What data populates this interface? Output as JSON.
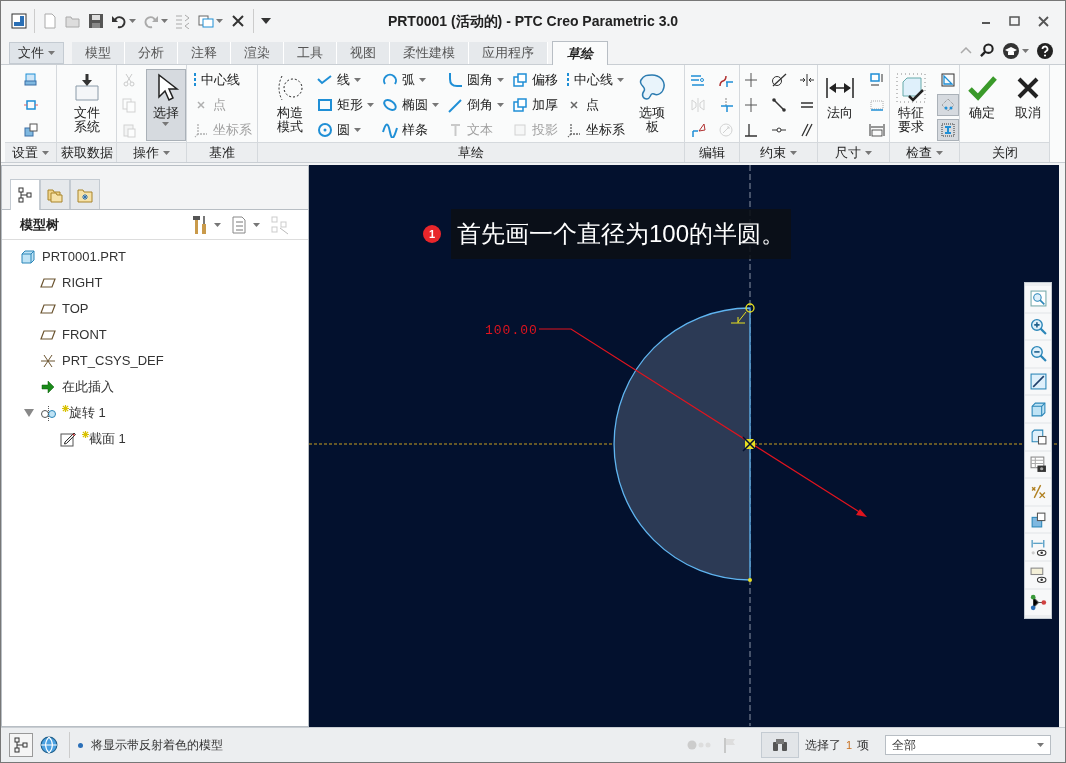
{
  "window": {
    "title": "PRT0001 (活动的) - PTC Creo Parametric 3.0"
  },
  "ribbon_tabs": [
    {
      "label": "文件",
      "kind": "menu",
      "selected": false
    },
    {
      "label": "模型",
      "kind": "tab",
      "selected": false
    },
    {
      "label": "分析",
      "kind": "tab",
      "selected": false
    },
    {
      "label": "注释",
      "kind": "tab",
      "selected": false
    },
    {
      "label": "渲染",
      "kind": "tab",
      "selected": false
    },
    {
      "label": "工具",
      "kind": "tab",
      "selected": false
    },
    {
      "label": "视图",
      "kind": "tab",
      "selected": false
    },
    {
      "label": "柔性建模",
      "kind": "tab",
      "selected": false
    },
    {
      "label": "应用程序",
      "kind": "tab",
      "selected": false
    },
    {
      "label": "草绘",
      "kind": "tab",
      "selected": true
    }
  ],
  "ribbon_groups": [
    {
      "label": "设置",
      "dropdown": true,
      "columns": [
        [
          {
            "kind": "icon",
            "dropdown": false,
            "disabled": false,
            "pressed": false
          },
          {
            "kind": "icon",
            "dropdown": false,
            "disabled": false,
            "pressed": false
          },
          {
            "kind": "icon",
            "dropdown": false,
            "disabled": false,
            "pressed": false
          }
        ]
      ]
    },
    {
      "label": "获取数据",
      "dropdown": false,
      "columns": [
        [
          {
            "kind": "large",
            "label": "文件系统",
            "dropdown": false,
            "disabled": false,
            "pressed": false
          }
        ]
      ]
    },
    {
      "label": "操作",
      "dropdown": true,
      "columns": [
        [
          {
            "kind": "icon",
            "dropdown": false,
            "disabled": true,
            "pressed": false
          },
          {
            "kind": "icon",
            "dropdown": false,
            "disabled": true,
            "pressed": false
          },
          {
            "kind": "icon",
            "dropdown": false,
            "disabled": true,
            "pressed": false
          }
        ],
        [
          {
            "kind": "large",
            "label": "选择",
            "dropdown": true,
            "disabled": false,
            "pressed": true
          }
        ]
      ]
    },
    {
      "label": "基准",
      "dropdown": false,
      "columns": [
        [
          {
            "kind": "small",
            "label": "中心线",
            "dropdown": false,
            "disabled": false,
            "pressed": false
          },
          {
            "kind": "small",
            "label": "点",
            "dropdown": false,
            "disabled": true,
            "pressed": false
          },
          {
            "kind": "small",
            "label": "坐标系",
            "dropdown": false,
            "disabled": true,
            "pressed": false
          }
        ]
      ]
    },
    {
      "label": "草绘",
      "dropdown": false,
      "columns": [
        [
          {
            "kind": "large",
            "label": "构造模式",
            "dropdown": false,
            "disabled": false,
            "pressed": false
          }
        ],
        [
          {
            "kind": "small",
            "label": "线",
            "dropdown": true,
            "disabled": false,
            "pressed": false
          },
          {
            "kind": "small",
            "label": "矩形",
            "dropdown": true,
            "disabled": false,
            "pressed": false
          },
          {
            "kind": "small",
            "label": "圆",
            "dropdown": true,
            "disabled": false,
            "pressed": false
          }
        ],
        [
          {
            "kind": "small",
            "label": "弧",
            "dropdown": true,
            "disabled": false,
            "pressed": false
          },
          {
            "kind": "small",
            "label": "椭圆",
            "dropdown": true,
            "disabled": false,
            "pressed": false
          },
          {
            "kind": "small",
            "label": "样条",
            "dropdown": false,
            "disabled": false,
            "pressed": false
          }
        ],
        [
          {
            "kind": "small",
            "label": "圆角",
            "dropdown": true,
            "disabled": false,
            "pressed": false
          },
          {
            "kind": "small",
            "label": "倒角",
            "dropdown": true,
            "disabled": false,
            "pressed": false
          },
          {
            "kind": "small",
            "label": "文本",
            "dropdown": false,
            "disabled": true,
            "pressed": false
          }
        ],
        [
          {
            "kind": "small",
            "label": "偏移",
            "dropdown": false,
            "disabled": false,
            "pressed": false
          },
          {
            "kind": "small",
            "label": "加厚",
            "dropdown": false,
            "disabled": false,
            "pressed": false
          },
          {
            "kind": "small",
            "label": "投影",
            "dropdown": false,
            "disabled": true,
            "pressed": false
          }
        ],
        [
          {
            "kind": "small",
            "label": "中心线",
            "dropdown": true,
            "disabled": false,
            "pressed": false
          },
          {
            "kind": "small",
            "label": "点",
            "dropdown": false,
            "disabled": false,
            "pressed": false
          },
          {
            "kind": "small",
            "label": "坐标系",
            "dropdown": false,
            "disabled": false,
            "pressed": false
          }
        ],
        [
          {
            "kind": "large",
            "label": "选项板",
            "dropdown": false,
            "disabled": false,
            "pressed": false
          }
        ]
      ]
    },
    {
      "label": "编辑",
      "dropdown": false,
      "columns": [
        [
          {
            "kind": "icon",
            "dropdown": false,
            "disabled": false,
            "pressed": false
          },
          {
            "kind": "icon",
            "dropdown": false,
            "disabled": true,
            "pressed": false
          },
          {
            "kind": "icon",
            "dropdown": false,
            "disabled": false,
            "pressed": false
          }
        ],
        [
          {
            "kind": "icon",
            "dropdown": false,
            "disabled": false,
            "pressed": false
          },
          {
            "kind": "icon",
            "dropdown": false,
            "disabled": false,
            "pressed": false
          },
          {
            "kind": "icon",
            "dropdown": false,
            "disabled": true,
            "pressed": false
          }
        ]
      ]
    },
    {
      "label": "约束",
      "dropdown": true,
      "columns": [
        [
          {
            "kind": "icon",
            "dropdown": false,
            "disabled": false,
            "pressed": false
          },
          {
            "kind": "icon",
            "dropdown": false,
            "disabled": false,
            "pressed": false
          },
          {
            "kind": "icon",
            "dropdown": false,
            "disabled": false,
            "pressed": false
          }
        ],
        [
          {
            "kind": "icon",
            "dropdown": false,
            "disabled": false,
            "pressed": false
          },
          {
            "kind": "icon",
            "dropdown": false,
            "disabled": false,
            "pressed": false
          },
          {
            "kind": "icon",
            "dropdown": false,
            "disabled": false,
            "pressed": false
          }
        ],
        [
          {
            "kind": "icon",
            "dropdown": false,
            "disabled": false,
            "pressed": false
          },
          {
            "kind": "icon",
            "dropdown": false,
            "disabled": false,
            "pressed": false
          },
          {
            "kind": "icon",
            "dropdown": false,
            "disabled": false,
            "pressed": false
          }
        ]
      ]
    },
    {
      "label": "尺寸",
      "dropdown": true,
      "columns": [
        [
          {
            "kind": "large",
            "label": "法向",
            "dropdown": false,
            "disabled": false,
            "pressed": false
          }
        ],
        [
          {
            "kind": "icon",
            "dropdown": false,
            "disabled": false,
            "pressed": false
          },
          {
            "kind": "icon",
            "dropdown": false,
            "disabled": false,
            "pressed": false
          },
          {
            "kind": "icon",
            "dropdown": false,
            "disabled": false,
            "pressed": false
          }
        ]
      ]
    },
    {
      "label": "检查",
      "dropdown": true,
      "columns": [
        [
          {
            "kind": "large",
            "label": "特征要求",
            "dropdown": false,
            "disabled": false,
            "pressed": false
          }
        ],
        [
          {
            "kind": "icon",
            "dropdown": false,
            "disabled": false,
            "pressed": false
          },
          {
            "kind": "icon",
            "dropdown": false,
            "disabled": false,
            "pressed": true
          },
          {
            "kind": "icon",
            "dropdown": false,
            "disabled": false,
            "pressed": true
          }
        ]
      ]
    },
    {
      "label": "关闭",
      "dropdown": false,
      "columns": [
        [
          {
            "kind": "large",
            "label": "确定",
            "dropdown": false,
            "disabled": false,
            "pressed": false
          }
        ],
        [
          {
            "kind": "large",
            "label": "取消",
            "dropdown": false,
            "disabled": false,
            "pressed": false
          }
        ]
      ]
    }
  ],
  "model_tree": {
    "title": "模型树",
    "tabs": [
      {
        "selected": true
      },
      {
        "selected": false
      },
      {
        "selected": false
      }
    ],
    "items": [
      {
        "kind": "part",
        "label": "PRT0001.PRT",
        "new": false,
        "children": [
          {
            "kind": "plane",
            "label": "RIGHT",
            "new": false
          },
          {
            "kind": "plane",
            "label": "TOP",
            "new": false
          },
          {
            "kind": "plane",
            "label": "FRONT",
            "new": false
          },
          {
            "kind": "csys",
            "label": "PRT_CSYS_DEF",
            "new": false
          },
          {
            "kind": "insert",
            "label": "在此插入",
            "new": false
          },
          {
            "kind": "revolve",
            "label": "旋转 1",
            "new": true,
            "expanded": true,
            "children": [
              {
                "kind": "sketch",
                "label": "截面 1",
                "new": true
              }
            ]
          }
        ]
      }
    ]
  },
  "canvas": {
    "dimension": "100.00",
    "annotation": {
      "number": "1",
      "text": "首先画一个直径为100的半圆。"
    }
  },
  "status_bar": {
    "message": "将显示带反射着色的模型",
    "selection": {
      "prefix": "选择了",
      "count": "1",
      "suffix": "项"
    },
    "filter": "全部"
  }
}
